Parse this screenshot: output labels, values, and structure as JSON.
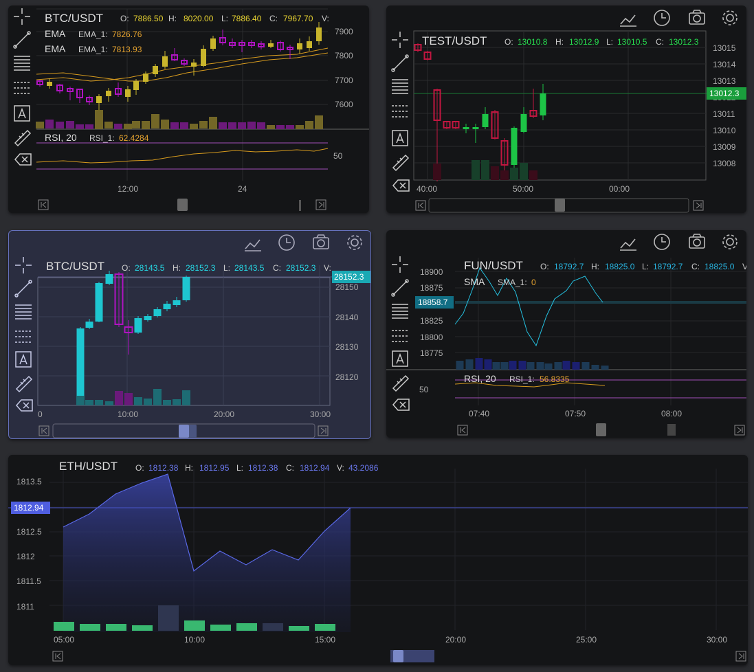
{
  "p1": {
    "symbol": "BTC/USDT",
    "ohlc": {
      "o_lbl": "O:",
      "o": "7886.50",
      "h_lbl": "H:",
      "h": "8020.00",
      "l_lbl": "L:",
      "l": "7886.40",
      "c_lbl": "C:",
      "c": "7967.70",
      "v_lbl": "V:"
    },
    "ema1": {
      "name": "EMA",
      "key": "EMA_1:",
      "value": "7826.76"
    },
    "ema2": {
      "name": "EMA",
      "key": "EMA_1:",
      "value": "7813.93"
    },
    "yticks": [
      "7900",
      "7800",
      "7700",
      "7600"
    ],
    "rsi": {
      "name": "RSI, 20",
      "key": "RSI_1:",
      "value": "62.4284",
      "level": "50"
    },
    "xticks": [
      "12:00",
      "24"
    ]
  },
  "p2": {
    "symbol": "TEST/USDT",
    "ohlc": {
      "o_lbl": "O:",
      "o": "13010.8",
      "h_lbl": "H:",
      "h": "13012.9",
      "l_lbl": "L:",
      "l": "13010.5",
      "c_lbl": "C:",
      "c": "13012.3"
    },
    "yticks": [
      "13015",
      "13014",
      "13013",
      "13012",
      "13011",
      "13010",
      "13009",
      "13008"
    ],
    "price_tag": "13012.3",
    "xticks": [
      "40:00",
      "50:00",
      "00:00"
    ]
  },
  "p3": {
    "symbol": "BTC/USDT",
    "ohlc": {
      "o_lbl": "O:",
      "o": "28143.5",
      "h_lbl": "H:",
      "h": "28152.3",
      "l_lbl": "L:",
      "l": "28143.5",
      "c_lbl": "C:",
      "c": "28152.3",
      "v_lbl": "V:"
    },
    "yticks": [
      "28150",
      "28140",
      "28130",
      "28120"
    ],
    "price_tag": "28152.3",
    "xticks": [
      "0",
      "10:00",
      "20:00",
      "30:00"
    ]
  },
  "p4": {
    "symbol": "FUN/USDT",
    "ohlc": {
      "o_lbl": "O:",
      "o": "18792.7",
      "h_lbl": "H:",
      "h": "18825.0",
      "l_lbl": "L:",
      "l": "18792.7",
      "c_lbl": "C:",
      "c": "18825.0",
      "v_lbl": "V"
    },
    "sma": {
      "name": "SMA",
      "key": "SMA_1:",
      "value": "0"
    },
    "yticks": [
      "18900",
      "18875",
      "18825",
      "18800",
      "18775"
    ],
    "price_tag": "18858.7",
    "rsi": {
      "name": "RSI, 20",
      "key": "RSI_1:",
      "value": "56.8335",
      "level": "50"
    },
    "xticks": [
      "07:40",
      "07:50",
      "08:00"
    ]
  },
  "p5": {
    "symbol": "ETH/USDT",
    "ohlc": {
      "o_lbl": "O:",
      "o": "1812.38",
      "h_lbl": "H:",
      "h": "1812.95",
      "l_lbl": "L:",
      "l": "1812.38",
      "c_lbl": "C:",
      "c": "1812.94",
      "v_lbl": "V:",
      "v": "43.2086"
    },
    "yticks": [
      "1813.5",
      "1813",
      "1812.5",
      "1812",
      "1811.5",
      "1811"
    ],
    "price_tag": "1812.94",
    "xticks": [
      "05:00",
      "10:00",
      "15:00",
      "20:00",
      "25:00",
      "30:00"
    ]
  },
  "icons": {
    "toolbar": [
      "chart-line-icon",
      "clock-icon",
      "camera-icon",
      "gear-icon"
    ],
    "drawing": [
      "crosshair-icon",
      "trend-line-icon",
      "fibonacci-icon",
      "pitchfork-icon",
      "text-tool-icon",
      "ruler-icon",
      "eraser-icon"
    ]
  },
  "colors": {
    "bull_yellow": "#c9b52c",
    "bear_magenta": "#b013c2",
    "green": "#1dc446",
    "red": "#c21640",
    "cyan": "#1ec6d1",
    "blue": "#5968e6"
  }
}
